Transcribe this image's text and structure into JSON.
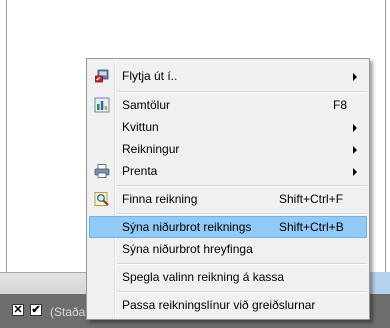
{
  "menu": {
    "items": [
      {
        "label": "Flytja út í..",
        "icon": "export-icon",
        "submenu": true
      },
      {
        "label": "Samtölur",
        "icon": "chart-icon",
        "shortcut": "F8"
      },
      {
        "label": "Kvittun",
        "submenu": true
      },
      {
        "label": "Reikningur",
        "submenu": true
      },
      {
        "label": "Prenta",
        "icon": "printer-icon",
        "submenu": true
      },
      {
        "label": "Finna reikning",
        "icon": "find-icon",
        "shortcut": "Shift+Ctrl+F"
      },
      {
        "label": "Sýna niðurbrot reiknings",
        "shortcut": "Shift+Ctrl+B",
        "highlighted": true
      },
      {
        "label": "Sýna niðurbrot hreyfinga"
      },
      {
        "label": "Spegla valinn reikning á kassa"
      },
      {
        "label": "Passa reikningslínur við greiðslurnar"
      }
    ]
  },
  "statusbar": {
    "checkbox1": "✕",
    "checkbox2": "✔",
    "text": "(Staða ="
  },
  "colors": {
    "highlight": "#91c9f7",
    "statusbar": "#6d6d6d"
  }
}
